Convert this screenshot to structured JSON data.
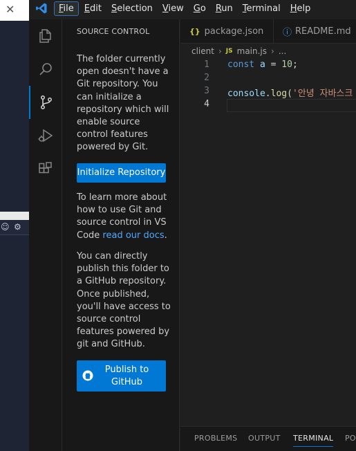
{
  "menu": {
    "items": [
      {
        "label": "File",
        "active": true
      },
      {
        "label": "Edit",
        "active": false
      },
      {
        "label": "Selection",
        "active": false
      },
      {
        "label": "View",
        "active": false
      },
      {
        "label": "Go",
        "active": false
      },
      {
        "label": "Run",
        "active": false
      },
      {
        "label": "Terminal",
        "active": false
      },
      {
        "label": "Help",
        "active": false
      }
    ]
  },
  "activity_bar": {
    "items": [
      {
        "icon": "explorer-icon",
        "selected": false
      },
      {
        "icon": "search-icon",
        "selected": false
      },
      {
        "icon": "source-control-icon",
        "selected": true
      },
      {
        "icon": "run-debug-icon",
        "selected": false
      },
      {
        "icon": "extensions-icon",
        "selected": false
      }
    ]
  },
  "sidebar": {
    "title": "SOURCE CONTROL",
    "intro": "The folder currently open doesn't have a Git repository. You can initialize a repository which will enable source control features powered by Git.",
    "init_button": "Initialize Repository",
    "learn_prefix": "To learn more about how to use Git and source control in VS Code ",
    "learn_link": "read our docs",
    "learn_suffix": ".",
    "publish_text": "You can directly publish this folder to a GitHub repository. Once published, you'll have access to source control features powered by git and GitHub.",
    "publish_button": "Publish to GitHub"
  },
  "editor": {
    "tabs": [
      {
        "icon": "{}",
        "label": "package.json"
      },
      {
        "icon": "ⓘ",
        "label": "README.md"
      }
    ],
    "breadcrumb": {
      "folder": "client",
      "file_icon": "JS",
      "file": "main.js",
      "more": "..."
    },
    "lines": [
      {
        "n": "1",
        "tokens": [
          {
            "t": "const ",
            "c": "kw"
          },
          {
            "t": "a",
            "c": "var"
          },
          {
            "t": " = ",
            "c": "plain"
          },
          {
            "t": "10",
            "c": "num"
          },
          {
            "t": ";",
            "c": "plain"
          }
        ]
      },
      {
        "n": "2",
        "tokens": []
      },
      {
        "n": "3",
        "tokens": [
          {
            "t": "console",
            "c": "var"
          },
          {
            "t": ".",
            "c": "plain"
          },
          {
            "t": "log",
            "c": "fn"
          },
          {
            "t": "(",
            "c": "plain"
          },
          {
            "t": "'안녕 자바스크",
            "c": "str"
          }
        ]
      },
      {
        "n": "4",
        "tokens": [],
        "current": true
      }
    ]
  },
  "panel": {
    "tabs": [
      {
        "label": "PROBLEMS",
        "active": false
      },
      {
        "label": "OUTPUT",
        "active": false
      },
      {
        "label": "TERMINAL",
        "active": true
      },
      {
        "label": "PO",
        "active": false
      }
    ]
  },
  "colors": {
    "accent": "#0078d4",
    "link": "#4daafc",
    "background": "#1f1f1f",
    "sidebar_background": "#181818"
  }
}
